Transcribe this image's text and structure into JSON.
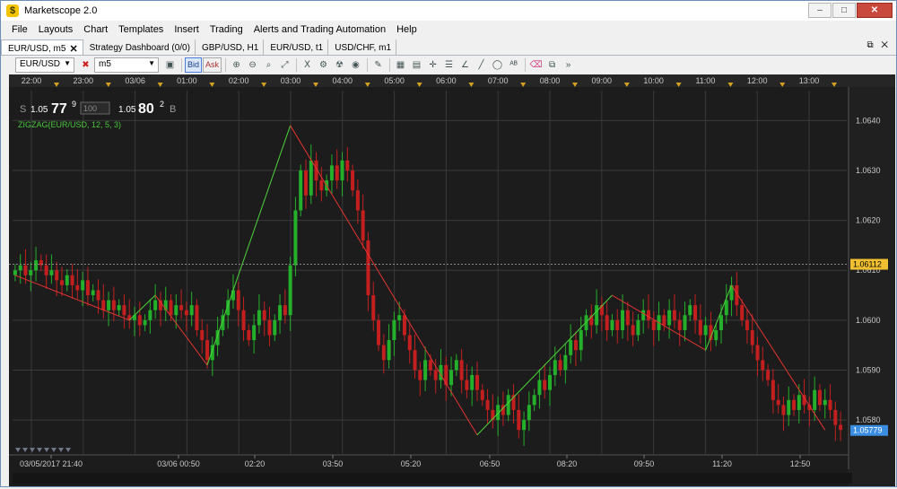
{
  "window": {
    "title": "Marketscope 2.0",
    "app_icon_glyph": "$",
    "controls": [
      "–",
      "□",
      "✕"
    ]
  },
  "menu": [
    "File",
    "Layouts",
    "Chart",
    "Templates",
    "Insert",
    "Trading",
    "Alerts and Trading Automation",
    "Help"
  ],
  "tabs": [
    {
      "label": "EUR/USD, m5",
      "active": true,
      "closable": true
    },
    {
      "label": "Strategy Dashboard (0/0)",
      "active": false
    },
    {
      "label": "GBP/USD, H1",
      "active": false
    },
    {
      "label": "EUR/USD, t1",
      "active": false
    },
    {
      "label": "USD/CHF, m1",
      "active": false
    }
  ],
  "tab_tools": "⧉ ✕",
  "toolbar": {
    "symbol": "EUR/USD",
    "period": "m5",
    "bid_label": "Bid",
    "ask_label": "Ask",
    "more": "»",
    "icons": [
      "chart-type-icon",
      "zoom-in-icon",
      "zoom-out-icon",
      "zoom-area-icon",
      "zoom-fit-icon",
      "indicator-icon",
      "strategy-icon",
      "signals-icon",
      "globe-icon",
      "ruler-icon",
      "picture-icon",
      "image-icon",
      "crosshair-icon",
      "lines-icon",
      "trend-icon",
      "pen-icon",
      "ellipse-icon",
      "text-icon",
      "eraser-icon",
      "network-icon"
    ]
  },
  "ticker": {
    "sell_label": "S",
    "sell_big": "1.05",
    "sell_pips": "77",
    "sell_frac": "9",
    "amount": "100",
    "buy_big": "1.05",
    "buy_pips": "80",
    "buy_frac": "2",
    "buy_label": "B"
  },
  "indicator_label": "ZIGZAG(EUR/USD, 12, 5, 3)",
  "top_time_labels": [
    "22:00",
    "23:00",
    "03/06",
    "01:00",
    "02:00",
    "03:00",
    "04:00",
    "05:00",
    "06:00",
    "07:00",
    "08:00",
    "09:00",
    "10:00",
    "11:00",
    "12:00",
    "13:00"
  ],
  "bottom_time_labels": [
    "03/05/2017 21:40",
    "03/06 00:50",
    "02:20",
    "03:50",
    "05:20",
    "06:50",
    "08:20",
    "09:50",
    "11:20",
    "12:50"
  ],
  "price_labels": [
    "1.0640",
    "1.0630",
    "1.0620",
    "1.0610",
    "1.0600",
    "1.0590",
    "1.0580"
  ],
  "price_markers": {
    "bid": "1.06112",
    "current": "1.05779"
  },
  "colors": {
    "bull": "#24b02a",
    "bear": "#c41f1f",
    "zigzag_up": "#4cd33a",
    "zigzag_down": "#e53333",
    "bg": "#1c1c1c",
    "grid": "#3a3a3a",
    "axis_text": "#c8c8c8"
  },
  "chart_data": {
    "type": "candlestick",
    "symbol": "EUR/USD",
    "period": "m5",
    "ylim": [
      1.0573,
      1.0646
    ],
    "price_ticks": [
      1.058,
      1.059,
      1.06,
      1.061,
      1.062,
      1.063,
      1.064
    ],
    "closes": [
      1.061,
      1.0611,
      1.0609,
      1.061,
      1.0612,
      1.0611,
      1.0609,
      1.061,
      1.0608,
      1.0607,
      1.0609,
      1.0607,
      1.0606,
      1.0608,
      1.0605,
      1.0606,
      1.0604,
      1.0602,
      1.0604,
      1.0602,
      1.0603,
      1.0601,
      1.06,
      1.0601,
      1.0599,
      1.06,
      1.0602,
      1.0604,
      1.0602,
      1.0604,
      1.0601,
      1.0603,
      1.0602,
      1.0601,
      1.0603,
      1.0598,
      1.0596,
      1.0592,
      1.0595,
      1.0598,
      1.0601,
      1.0604,
      1.0606,
      1.0602,
      1.0598,
      1.0596,
      1.0599,
      1.0602,
      1.06,
      1.0597,
      1.06,
      1.0603,
      1.0601,
      1.0611,
      1.0622,
      1.063,
      1.0625,
      1.0632,
      1.0628,
      1.0626,
      1.0628,
      1.0631,
      1.0628,
      1.0632,
      1.063,
      1.0626,
      1.0622,
      1.0616,
      1.0605,
      1.06,
      1.0595,
      1.0592,
      1.0596,
      1.06,
      1.0601,
      1.0597,
      1.0594,
      1.059,
      1.0588,
      1.0592,
      1.059,
      1.0588,
      1.0591,
      1.0587,
      1.059,
      1.0592,
      1.0588,
      1.0586,
      1.0589,
      1.0586,
      1.0584,
      1.0582,
      1.058,
      1.0583,
      1.0581,
      1.0585,
      1.0582,
      1.0578,
      1.058,
      1.0583,
      1.0585,
      1.0588,
      1.0586,
      1.0589,
      1.0592,
      1.059,
      1.0593,
      1.0596,
      1.0594,
      1.0598,
      1.0601,
      1.0599,
      1.0603,
      1.0601,
      1.0598,
      1.06,
      1.0598,
      1.0602,
      1.0599,
      1.0597,
      1.06,
      1.0602,
      1.06,
      1.0598,
      1.0601,
      1.0599,
      1.0602,
      1.06,
      1.0598,
      1.0601,
      1.0603,
      1.06,
      1.0597,
      1.0599,
      1.0596,
      1.0598,
      1.0601,
      1.0604,
      1.0607,
      1.0603,
      1.06,
      1.0598,
      1.0595,
      1.0592,
      1.059,
      1.0588,
      1.0584,
      1.0583,
      1.0581,
      1.0584,
      1.0582,
      1.0585,
      1.0583,
      1.0582,
      1.0586,
      1.0583,
      1.0584,
      1.0582,
      1.0579,
      1.0578
    ],
    "zigzag": [
      {
        "i": 0,
        "p": 1.0609
      },
      {
        "i": 22,
        "p": 1.06
      },
      {
        "i": 27,
        "p": 1.0605
      },
      {
        "i": 37,
        "p": 1.0591
      },
      {
        "i": 53,
        "p": 1.0639
      },
      {
        "i": 89,
        "p": 1.0577
      },
      {
        "i": 115,
        "p": 1.0605
      },
      {
        "i": 133,
        "p": 1.0594
      },
      {
        "i": 138,
        "p": 1.0607
      },
      {
        "i": 156,
        "p": 1.0578
      }
    ]
  }
}
